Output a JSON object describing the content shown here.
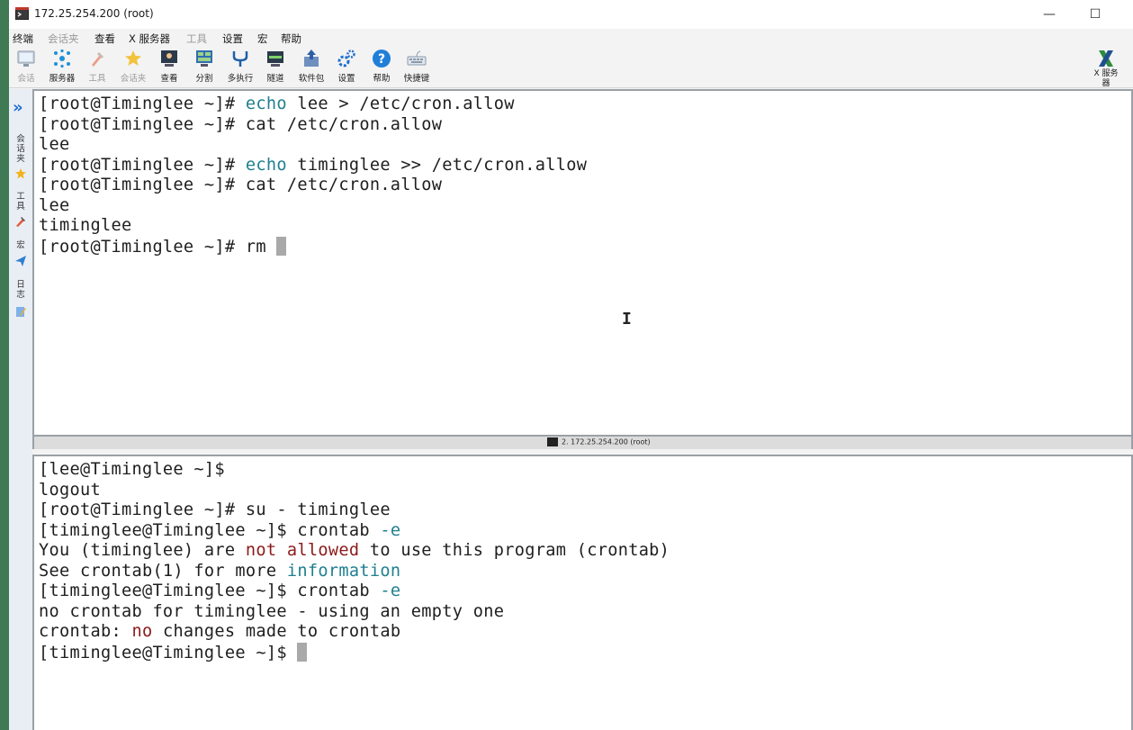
{
  "window": {
    "title": "172.25.254.200 (root)",
    "minimize_glyph": "—",
    "maximize_glyph": "☐"
  },
  "menu": [
    {
      "label": "终端",
      "enabled": true
    },
    {
      "label": "会话夹",
      "enabled": false
    },
    {
      "label": "查看",
      "enabled": true
    },
    {
      "label": "X 服务器",
      "enabled": true
    },
    {
      "label": "工具",
      "enabled": false
    },
    {
      "label": "设置",
      "enabled": true
    },
    {
      "label": "宏",
      "enabled": true
    },
    {
      "label": "帮助",
      "enabled": true
    }
  ],
  "toolbar": [
    {
      "label": "会话",
      "icon": "session-icon",
      "enabled": false
    },
    {
      "label": "服务器",
      "icon": "servers-icon",
      "enabled": true
    },
    {
      "label": "工具",
      "icon": "tools-icon",
      "enabled": false
    },
    {
      "label": "会话夹",
      "icon": "sessions-star-icon",
      "enabled": false
    },
    {
      "label": "查看",
      "icon": "view-icon",
      "enabled": true
    },
    {
      "label": "分割",
      "icon": "split-icon",
      "enabled": true
    },
    {
      "label": "多执行",
      "icon": "multiexec-icon",
      "enabled": true
    },
    {
      "label": "隧道",
      "icon": "tunnel-icon",
      "enabled": true
    },
    {
      "label": "软件包",
      "icon": "packages-icon",
      "enabled": true
    },
    {
      "label": "设置",
      "icon": "settings-gear-icon",
      "enabled": true
    },
    {
      "label": "帮助",
      "icon": "help-icon",
      "enabled": true
    },
    {
      "label": "快捷键",
      "icon": "keyboard-icon",
      "enabled": true
    }
  ],
  "xserver": {
    "label_line1": "X 服务",
    "label_line2": "器"
  },
  "sidebar": {
    "items": [
      {
        "label": "会话夹"
      },
      {
        "label": "工具"
      },
      {
        "label": "宏"
      },
      {
        "label": "日志"
      }
    ]
  },
  "pane1": {
    "status_label": "2. 172.25.254.200 (root)",
    "lines": [
      [
        {
          "t": "[root@Timinglee ~]# "
        },
        {
          "t": "echo",
          "c": "cmd"
        },
        {
          "t": " lee > /etc/cron.allow"
        }
      ],
      [
        {
          "t": "[root@Timinglee ~]# cat /etc/cron.allow"
        }
      ],
      [
        {
          "t": "lee"
        }
      ],
      [
        {
          "t": "[root@Timinglee ~]# "
        },
        {
          "t": "echo",
          "c": "cmd"
        },
        {
          "t": " timinglee >> /etc/cron.allow"
        }
      ],
      [
        {
          "t": "[root@Timinglee ~]# cat /etc/cron.allow"
        }
      ],
      [
        {
          "t": "lee"
        }
      ],
      [
        {
          "t": "timinglee"
        }
      ],
      [
        {
          "t": "[root@Timinglee ~]# rm "
        },
        {
          "cursor": true
        }
      ]
    ]
  },
  "pane2": {
    "lines": [
      [
        {
          "t": "[lee@Timinglee ~]$"
        }
      ],
      [
        {
          "t": "logout"
        }
      ],
      [
        {
          "t": "[root@Timinglee ~]# su - timinglee"
        }
      ],
      [
        {
          "t": "[timinglee@Timinglee ~]$ crontab "
        },
        {
          "t": "-e",
          "c": "cmd"
        }
      ],
      [
        {
          "t": "You (timinglee) are "
        },
        {
          "t": "not allowed",
          "c": "err"
        },
        {
          "t": " to use this program (crontab)"
        }
      ],
      [
        {
          "t": "See crontab(1) for more "
        },
        {
          "t": "information",
          "c": "hl"
        }
      ],
      [
        {
          "t": "[timinglee@Timinglee ~]$ crontab "
        },
        {
          "t": "-e",
          "c": "cmd"
        }
      ],
      [
        {
          "t": "no crontab for timinglee - using an empty one"
        }
      ],
      [
        {
          "t": "crontab: "
        },
        {
          "t": "no",
          "c": "err"
        },
        {
          "t": " changes made to crontab"
        }
      ],
      [
        {
          "t": "[timinglee@Timinglee ~]$ "
        },
        {
          "cursor": true
        }
      ]
    ]
  },
  "colors": {
    "command": "#1f7f8f",
    "error": "#8b1a1a",
    "cursor": "#a9a9a9"
  }
}
